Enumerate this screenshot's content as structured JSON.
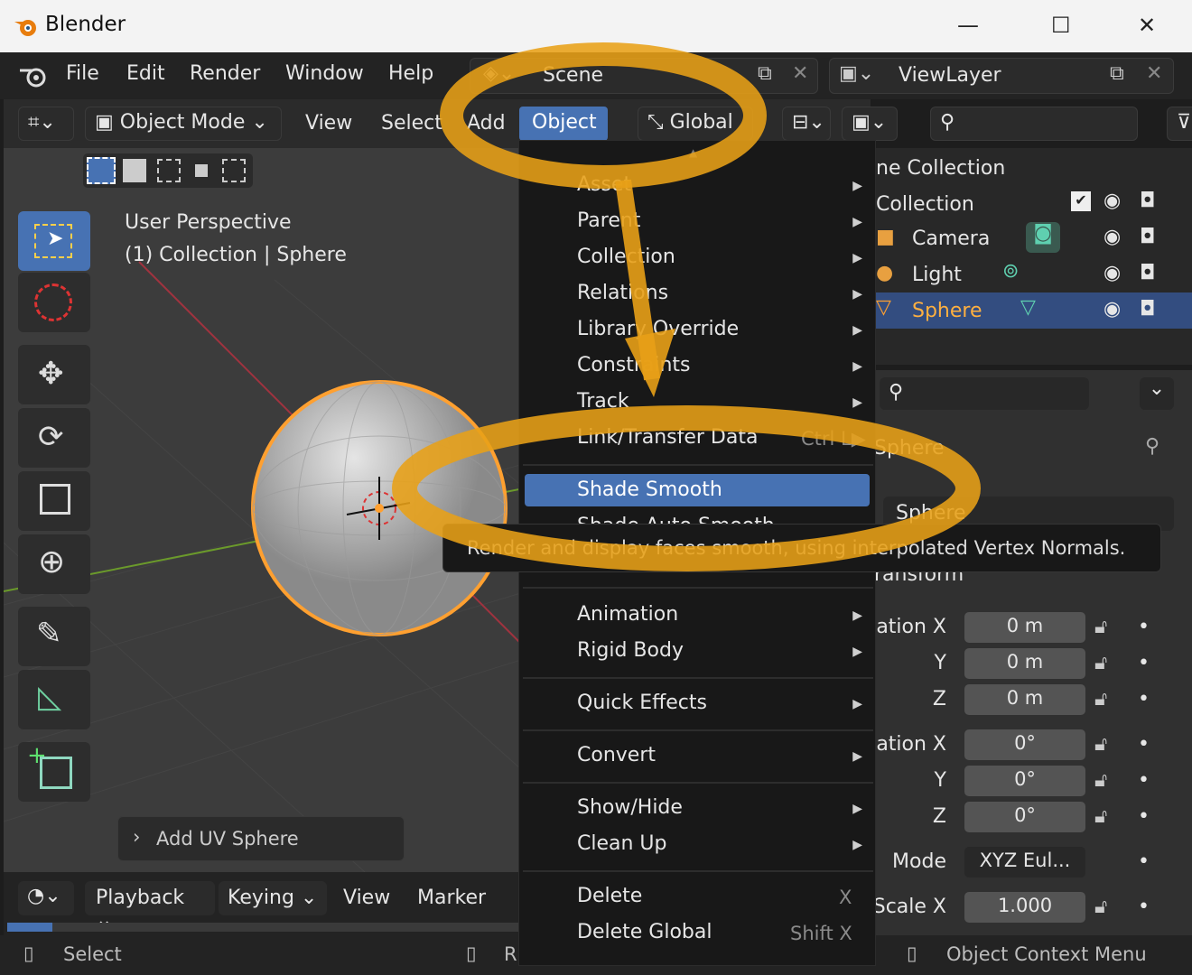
{
  "window": {
    "title": "Blender",
    "min": "—",
    "max": "☐",
    "close": "✕"
  },
  "menubar": {
    "items": [
      "File",
      "Edit",
      "Render",
      "Window",
      "Help"
    ],
    "scene": "Scene",
    "viewlayer": "ViewLayer"
  },
  "viewport_header": {
    "mode": "Object Mode",
    "menus": [
      "View",
      "Select",
      "Add",
      "Object"
    ],
    "transform": "Global"
  },
  "viewport": {
    "perspective": "User Perspective",
    "collection_info": "(1) Collection | Sphere",
    "last_op": "Add UV Sphere"
  },
  "object_menu": {
    "items": [
      {
        "label": "Asset",
        "arrow": "▶"
      },
      {
        "label": "Parent",
        "arrow": "▶"
      },
      {
        "label": "Collection",
        "arrow": "▶"
      },
      {
        "label": "Relations",
        "arrow": "▶"
      },
      {
        "label": "Library Override",
        "arrow": "▶"
      },
      {
        "label": "Constraints",
        "arrow": "▶"
      },
      {
        "label": "Track",
        "arrow": "▶"
      },
      {
        "label": "Link/Transfer Data",
        "shortcut": "Ctrl L▶"
      },
      {
        "label": "Shade Smooth"
      },
      {
        "label": "Shade Auto Smooth"
      },
      {
        "label": "Animation",
        "arrow": "▶"
      },
      {
        "label": "Rigid Body",
        "arrow": "▶"
      },
      {
        "label": "Quick Effects",
        "arrow": "▶"
      },
      {
        "label": "Convert",
        "arrow": "▶"
      },
      {
        "label": "Show/Hide",
        "arrow": "▶"
      },
      {
        "label": "Clean Up",
        "arrow": "▶"
      },
      {
        "label": "Delete",
        "shortcut": "X"
      },
      {
        "label": "Delete Global",
        "shortcut": "Shift X"
      }
    ]
  },
  "tooltip": "Render and display faces smooth, using interpolated Vertex Normals.",
  "outliner": {
    "scene_collection": "ne Collection",
    "collection": "Collection",
    "rows": [
      "Camera",
      "Light",
      "Sphere"
    ]
  },
  "properties": {
    "object_name": "Sphere",
    "data_name": "Sphere",
    "section": "ransform",
    "rows": [
      {
        "label": "ation X",
        "value": "0 m"
      },
      {
        "label": "Y",
        "value": "0 m"
      },
      {
        "label": "Z",
        "value": "0 m"
      },
      {
        "label": "ation X",
        "value": "0°"
      },
      {
        "label": "Y",
        "value": "0°"
      },
      {
        "label": "Z",
        "value": "0°"
      },
      {
        "label": "Mode",
        "value": "XYZ Eul..."
      },
      {
        "label": "Scale X",
        "value": "1.000"
      }
    ]
  },
  "timeline": {
    "items": [
      "Playback",
      "Keying",
      "View",
      "Marker"
    ]
  },
  "statusbar": {
    "left": "Select",
    "mid": "R",
    "right": "Object Context Menu"
  },
  "colors": {
    "accent": "#4772b3",
    "selection": "#ffa030",
    "annotation": "#e8a017"
  }
}
